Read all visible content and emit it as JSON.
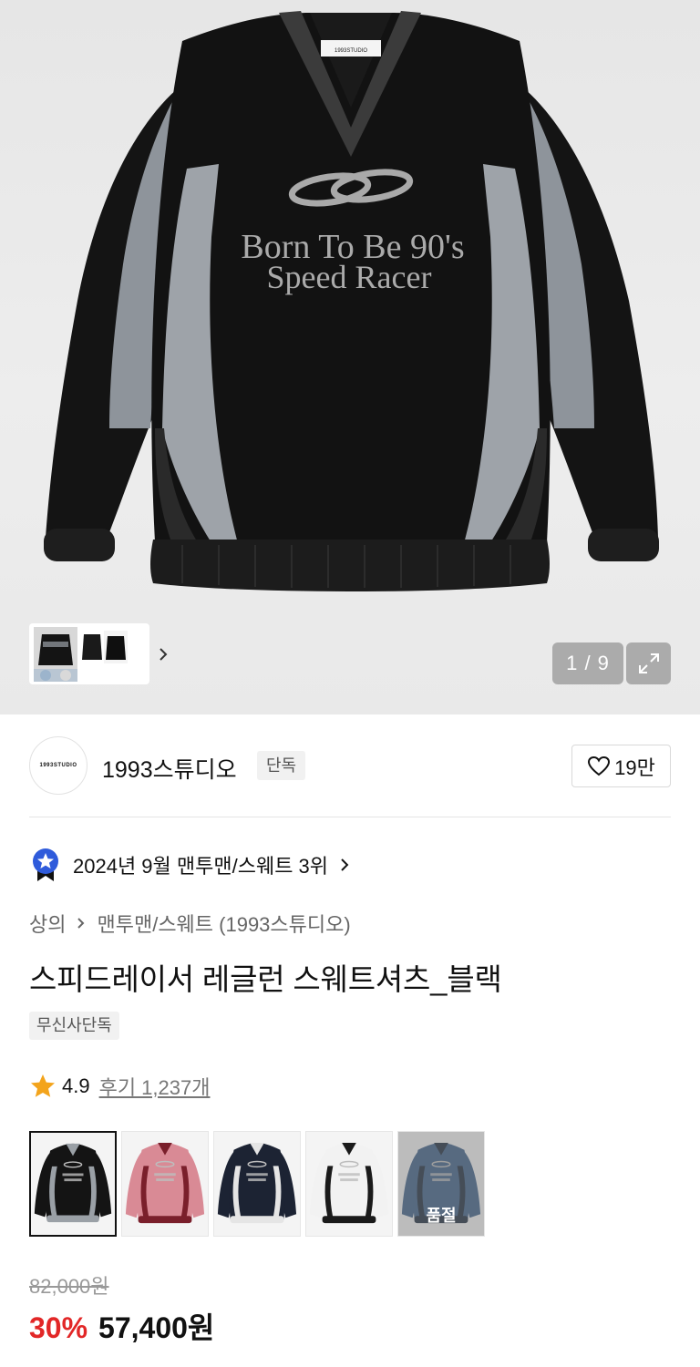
{
  "gallery": {
    "print_line1": "Born To Be 90's",
    "print_line2": "Speed Racer",
    "neck_label": "1993STUDIO",
    "counter": "1 / 9",
    "next_icon": "chevron-right-icon",
    "expand_icon": "expand-icon"
  },
  "brand": {
    "logo_text": "1993STUDIO",
    "name": "1993스튜디오",
    "tag": "단독",
    "like_icon": "heart-icon",
    "like_count": "19만"
  },
  "ranking": {
    "icon": "ranking-badge-icon",
    "text": "2024년 9월 맨투맨/스웨트 3위"
  },
  "breadcrumb": {
    "level1": "상의",
    "level2": "맨투맨/스웨트 (1993스튜디오)"
  },
  "product": {
    "title": "스피드레이서 레글런 스웨트셔츠_블랙",
    "exclusive_tag": "무신사단독"
  },
  "rating": {
    "score": "4.9",
    "reviews": "후기 1,237개"
  },
  "variants": [
    {
      "color_name": "black",
      "body": "#141414",
      "accent": "#9aa0a6",
      "selected": true,
      "soldout": false
    },
    {
      "color_name": "pink",
      "body": "#d98a95",
      "accent": "#7a1f2b",
      "selected": false,
      "soldout": false
    },
    {
      "color_name": "navy",
      "body": "#1c2333",
      "accent": "#e5e5e5",
      "selected": false,
      "soldout": false
    },
    {
      "color_name": "white",
      "body": "#f2f2f2",
      "accent": "#1a1a1a",
      "selected": false,
      "soldout": false
    },
    {
      "color_name": "blue",
      "body": "#3c5f88",
      "accent": "#1c2a3c",
      "selected": false,
      "soldout": true,
      "soldout_label": "품절"
    }
  ],
  "price": {
    "original": "82,000원",
    "discount": "30%",
    "sale": "57,400원"
  },
  "colors": {
    "discount_red": "#e22727",
    "muted_text": "#666666"
  }
}
